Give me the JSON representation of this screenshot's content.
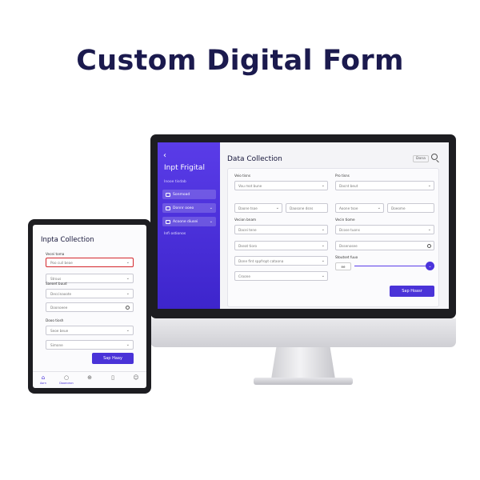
{
  "hero": {
    "title": "Custom Digital Form"
  },
  "monitor": {
    "sidebar": {
      "back_icon": "chevron-left-icon",
      "brand": "Inpt Frigital",
      "section": "Inooe tisdab",
      "items": [
        {
          "label": "Sonmoad",
          "icon": "form-icon"
        },
        {
          "label": "Donnr ooeo",
          "icon": "grid-icon"
        },
        {
          "label": "Acoone diusei",
          "icon": "settings-icon"
        }
      ],
      "footer": "Infi ostionos"
    },
    "header": {
      "title": "Data Collection",
      "done_label": "Dona",
      "search_icon": "search-icon"
    },
    "form": {
      "left": {
        "label_1": "Veio tisns",
        "select_1": "Vou mot bune",
        "input_pair_1a": "Daone tsoe",
        "input_pair_1b": "Daosone dsns",
        "label_2": "Vecion bnam",
        "select_2": "Dacei tene",
        "select_3": "Dseat tioro",
        "select_4": "Done fint sppfropt cataona",
        "select_5": "Croone"
      },
      "right": {
        "label_1": "Pro tisns",
        "select_1": "Dacnt beut",
        "input_pair_1a": "Aoone tsoe",
        "input_pair_1b": "Doeome",
        "label_2": "Vecin tiome",
        "select_2": "Dcose tuons",
        "input_1": "Dssenosee",
        "label_3": "Stoutset fuuo",
        "slider_tag": "ee",
        "slider_value": 1.0
      },
      "submit_label": "Sap Hoasr"
    }
  },
  "tablet": {
    "title": "Inpta Collection",
    "fields": {
      "label_1": "Vecei toma",
      "select_1": "Poo cuil beae",
      "select_2": "Strous",
      "label_2": "Saeoet buud",
      "select_3": "Deccinaoote",
      "input_1": "Doonoeee",
      "label_3": "Dooo tiosh",
      "select_4": "Seoe beue",
      "select_5": "Simone"
    },
    "submit_label": "Sap Haay",
    "nav": [
      {
        "label": "Aorn",
        "icon": "home-icon"
      },
      {
        "label": "Dooeceon",
        "icon": "chat-icon"
      },
      {
        "label": "",
        "icon": "plus-icon"
      },
      {
        "label": "",
        "icon": "document-icon"
      },
      {
        "label": "",
        "icon": "user-icon"
      }
    ]
  },
  "colors": {
    "accent": "#4a33d8",
    "title": "#1b1a4e",
    "error": "#d4262c"
  }
}
